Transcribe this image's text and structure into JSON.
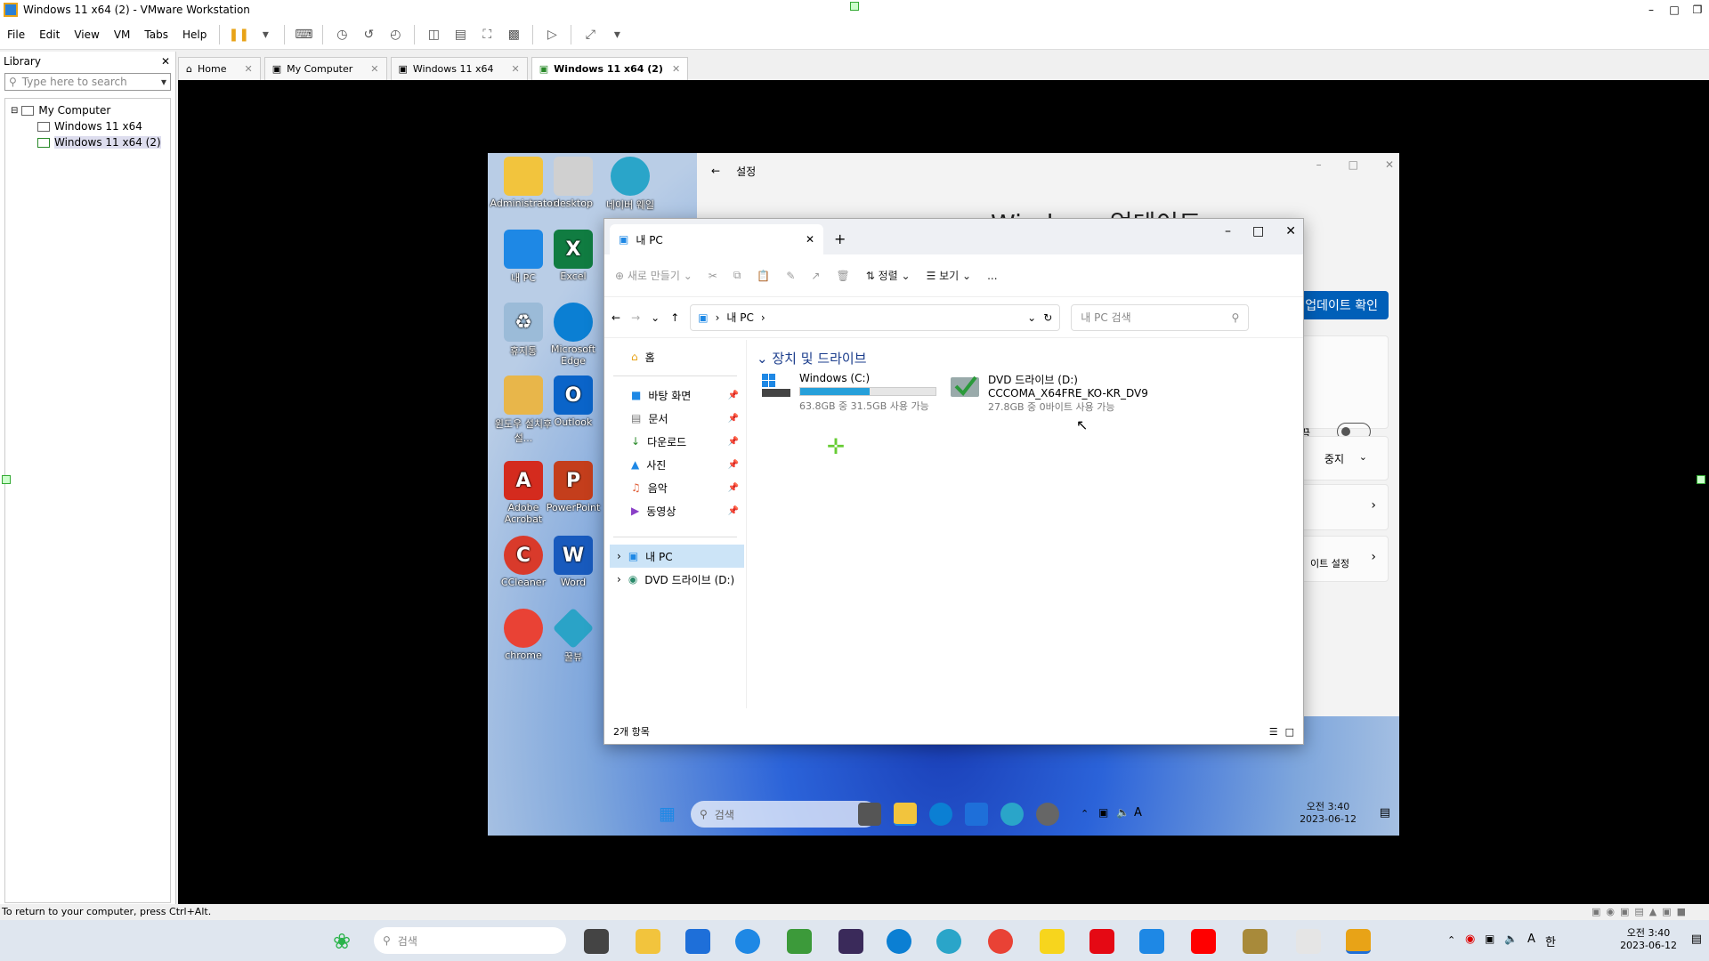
{
  "window": {
    "title": "Windows 11 x64 (2) - VMware Workstation"
  },
  "menubar": {
    "items": [
      "File",
      "Edit",
      "View",
      "VM",
      "Tabs",
      "Help"
    ]
  },
  "library": {
    "title": "Library",
    "search_placeholder": "Type here to search",
    "tree": [
      {
        "label": "My Computer"
      },
      {
        "label": "Windows 11 x64"
      },
      {
        "label": "Windows 11 x64 (2)"
      }
    ]
  },
  "tabs": [
    {
      "label": "Home"
    },
    {
      "label": "My Computer"
    },
    {
      "label": "Windows 11 x64"
    },
    {
      "label": "Windows 11 x64 (2)"
    }
  ],
  "guest": {
    "desktop_icons": [
      {
        "label": "Administrator",
        "color": "#f2c43d"
      },
      {
        "label": "desktop",
        "color": "#d0d0d0"
      },
      {
        "label": "네이버 웨일",
        "color": "#2aa5c9"
      },
      {
        "label": "내 PC",
        "color": "#1e88e5"
      },
      {
        "label": "Excel",
        "color": "#107c41"
      },
      {
        "label": "휴지통",
        "color": "#9bbbd8"
      },
      {
        "label": "Microsoft Edge",
        "color": "#0b7fd3"
      },
      {
        "label": "윈도우 설치후 설...",
        "color": "#e8b64a"
      },
      {
        "label": "Outlook",
        "color": "#0a64c9"
      },
      {
        "label": "Adobe Acrobat",
        "color": "#d42b1e"
      },
      {
        "label": "PowerPoint",
        "color": "#c43e1c"
      },
      {
        "label": "CCleaner",
        "color": "#d93a2b"
      },
      {
        "label": "Word",
        "color": "#185abd"
      },
      {
        "label": "chrome",
        "color": "#e94235"
      },
      {
        "label": "꿀뷰",
        "color": "#2aa3c7"
      }
    ],
    "settings": {
      "title": "설정",
      "heading": "Windows 업데이트",
      "update_button": "업데이트 확인",
      "toggle_label": "끔",
      "pause_label": "중지",
      "advanced_label": "이트 설정"
    },
    "explorer": {
      "tab_title": "내 PC",
      "toolbar": {
        "new_label": "새로 만들기",
        "sort_label": "정렬",
        "view_label": "보기",
        "more_label": "..."
      },
      "breadcrumb": "내 PC",
      "search_placeholder": "내 PC 검색",
      "nav": {
        "home": "홈",
        "pinned": [
          "바탕 화면",
          "문서",
          "다운로드",
          "사진",
          "음악",
          "동영상"
        ],
        "this_pc": "내 PC",
        "dvd": "DVD 드라이브 (D:)"
      },
      "group_title": "장치 및 드라이브",
      "drives": [
        {
          "name": "Windows (C:)",
          "sub": "",
          "free": "63.8GB 중 31.5GB 사용 가능",
          "usage": 0.51
        },
        {
          "name": "DVD 드라이브 (D:)",
          "sub": "CCCOMA_X64FRE_KO-KR_DV9",
          "free": "27.8GB 중 0바이트 사용 가능",
          "usage": 1.0
        }
      ],
      "status": "2개 항목"
    },
    "taskbar": {
      "search_placeholder": "검색",
      "time": "오전 3:40",
      "date": "2023-06-12",
      "ime": "A"
    }
  },
  "status_bar": {
    "hint": "To return to your computer, press Ctrl+Alt."
  },
  "host_taskbar": {
    "search_placeholder": "검색",
    "time": "오전 3:40",
    "date": "2023-06-12",
    "ime": "A",
    "ime2": "한"
  }
}
